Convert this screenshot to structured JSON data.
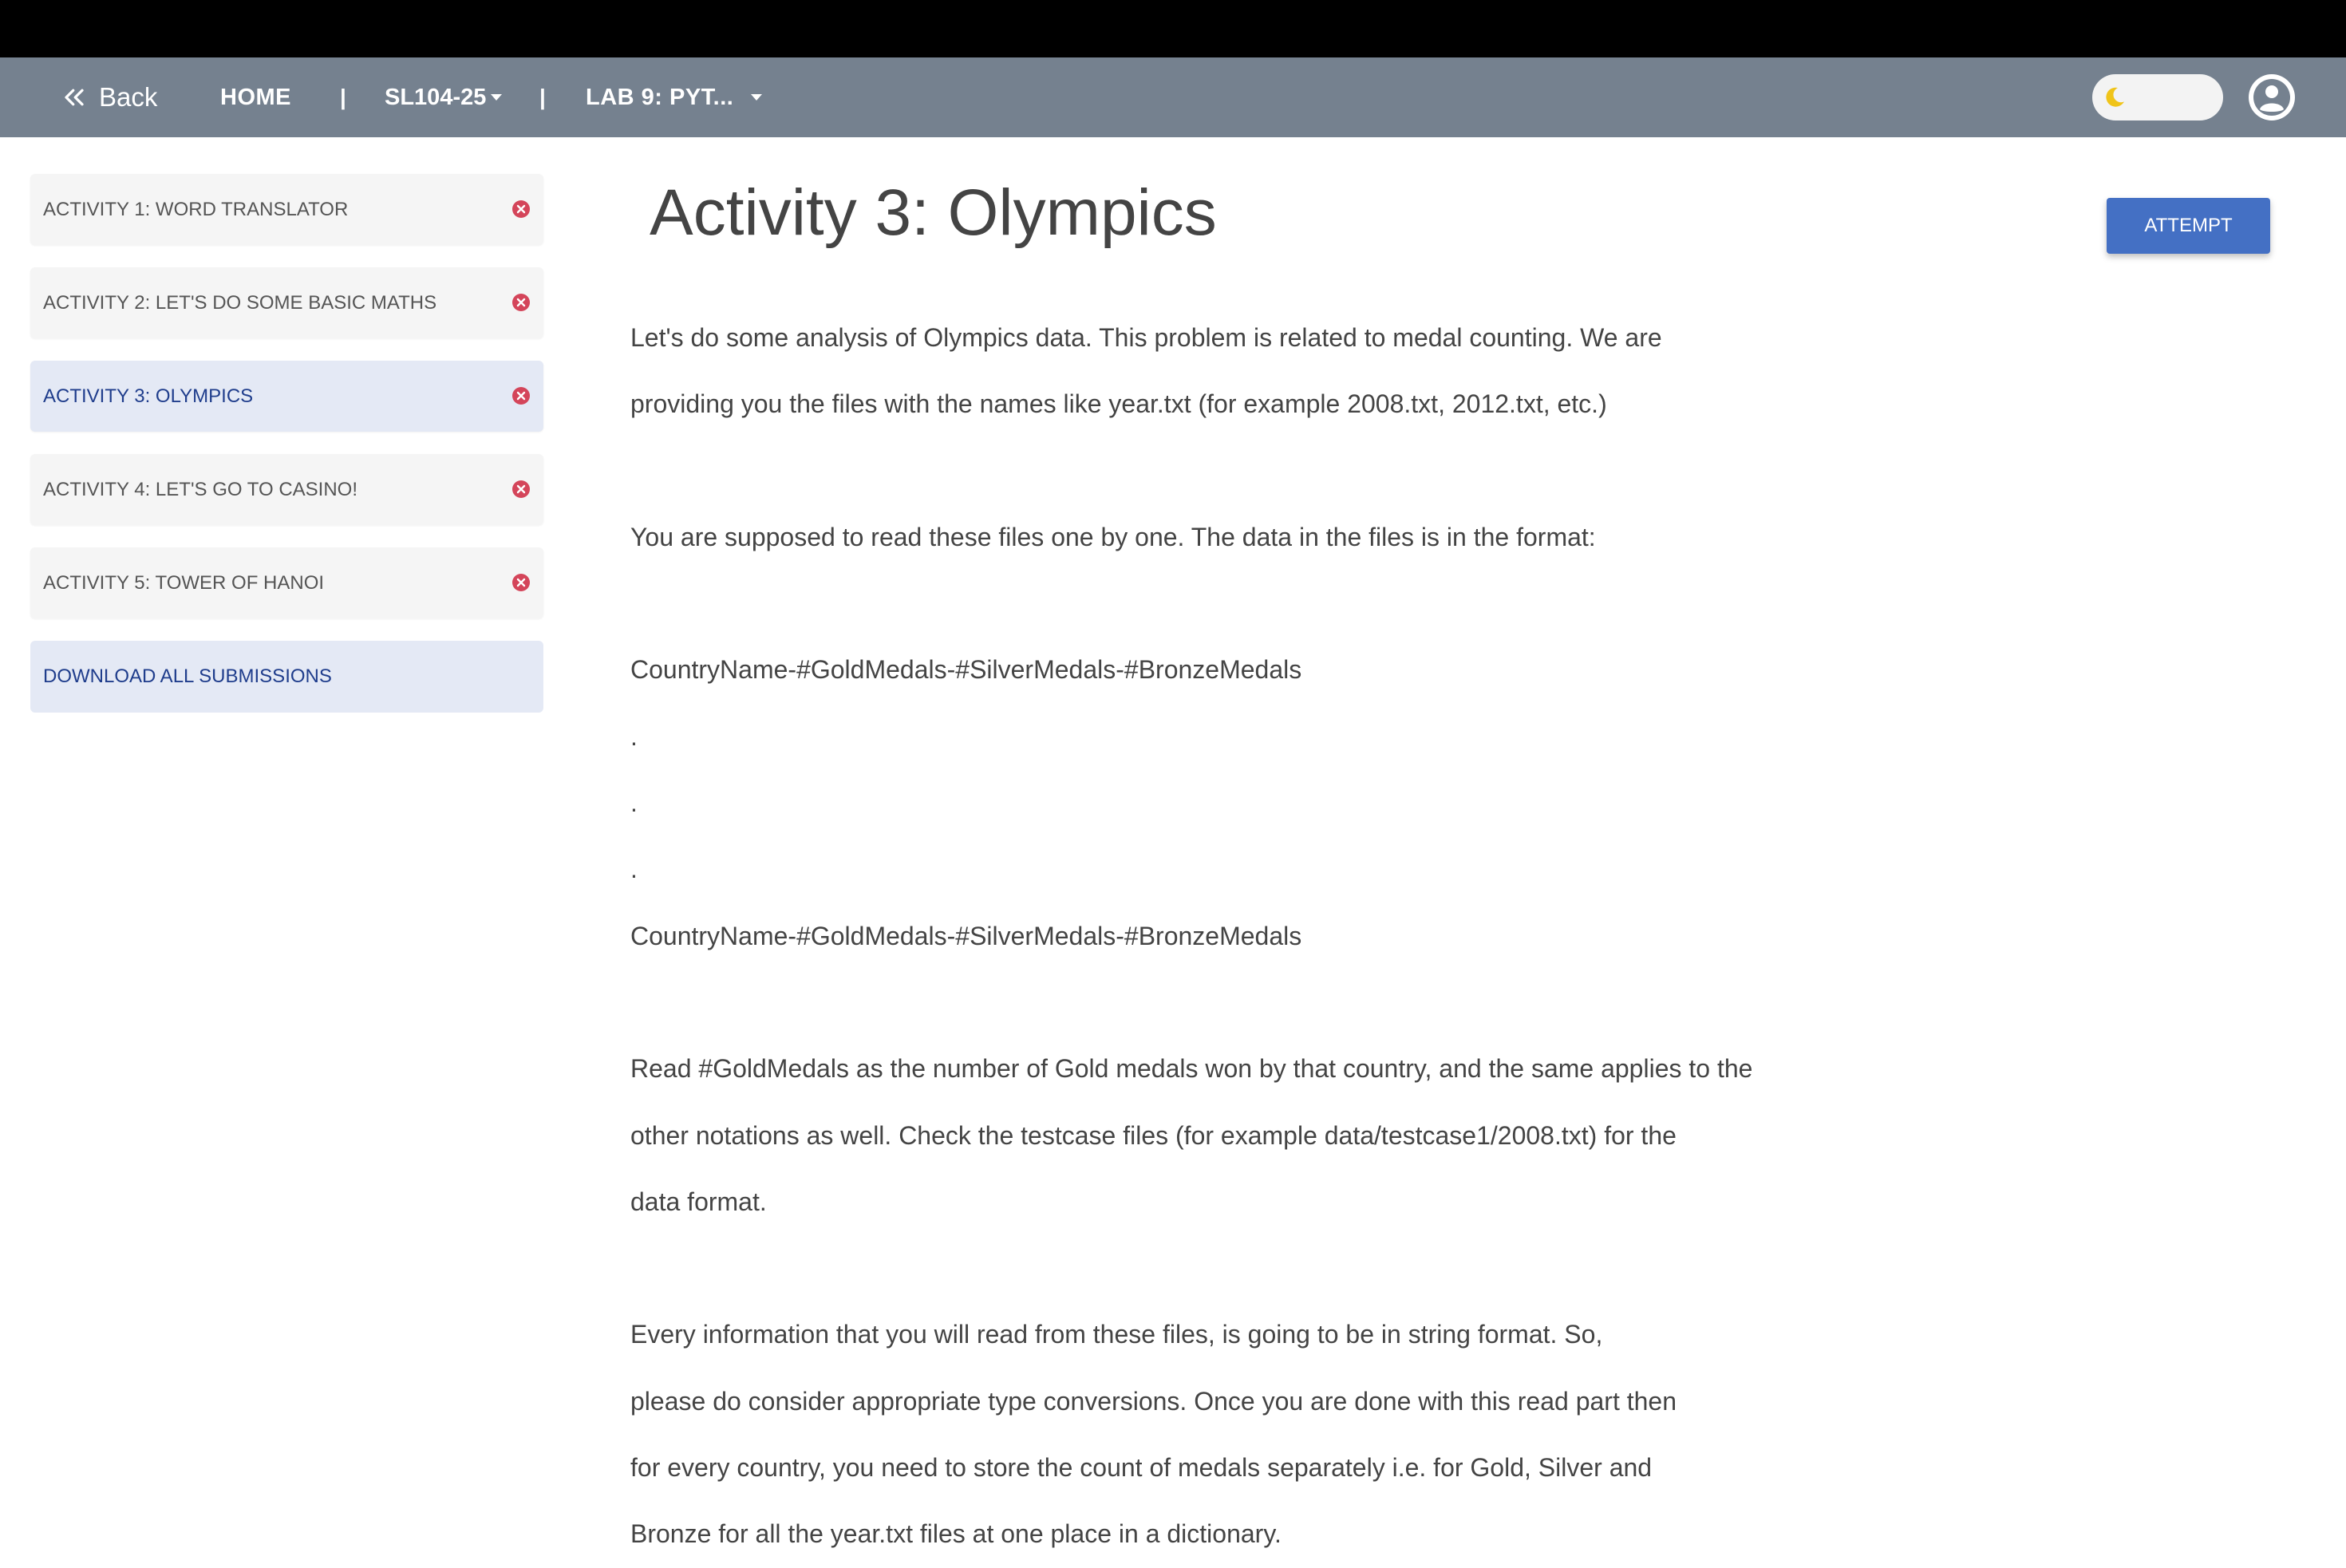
{
  "nav": {
    "back_label": "Back",
    "home_label": "HOME",
    "separator": "|",
    "course_label": "SL104-25",
    "lab_label": "LAB 9: PYT..."
  },
  "colors": {
    "navbar": "#75818f",
    "accent": "#4470c4",
    "active_item_bg": "#e4e9f5",
    "error_icon": "#d4455a",
    "moon": "#f0c419"
  },
  "sidebar": {
    "activities": [
      {
        "label": "ACTIVITY 1: WORD TRANSLATOR",
        "status_icon": "x-circle-icon"
      },
      {
        "label": "ACTIVITY 2: LET'S DO SOME BASIC MATHS",
        "status_icon": "x-circle-icon"
      },
      {
        "label": "ACTIVITY 3: OLYMPICS",
        "status_icon": "x-circle-icon",
        "active": true
      },
      {
        "label": "ACTIVITY 4: LET'S GO TO CASINO!",
        "status_icon": "x-circle-icon"
      },
      {
        "label": "ACTIVITY 5: TOWER OF HANOI",
        "status_icon": "x-circle-icon"
      }
    ],
    "download_label": "DOWNLOAD ALL SUBMISSIONS"
  },
  "main": {
    "title": "Activity 3: Olympics",
    "attempt_label": "ATTEMPT",
    "lines": [
      "Let's do some analysis of Olympics data. This problem is related to medal counting. We are",
      "providing you the files with the names like year.txt (for example 2008.txt, 2012.txt, etc.)",
      "",
      "You are supposed to read these files one by one. The data in the files is in the format:",
      "",
      "CountryName-#GoldMedals-#SilverMedals-#BronzeMedals",
      ".",
      ".",
      ".",
      "CountryName-#GoldMedals-#SilverMedals-#BronzeMedals",
      "",
      "Read #GoldMedals as the number of Gold medals won by that country, and the same applies to the",
      "other notations as well. Check the testcase files (for example data/testcase1/2008.txt) for the",
      "data format.",
      "",
      "Every information that you will read from these files, is going to be in string format. So,",
      "please do consider appropriate type conversions. Once you are done with this read part then",
      "for every country, you need to store the count of medals separately i.e. for Gold, Silver and",
      "Bronze for all the year.txt files at one place in a dictionary."
    ]
  }
}
